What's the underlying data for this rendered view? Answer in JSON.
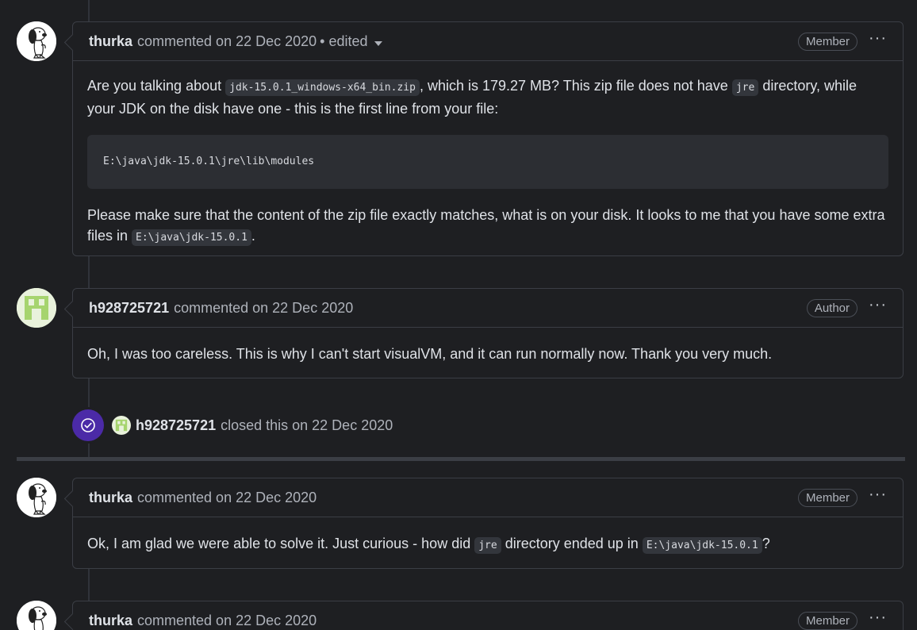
{
  "comments": [
    {
      "author": "thurka",
      "meta": "commented on 22 Dec 2020",
      "edited": "• edited",
      "role": "Member",
      "avatar_icon": "snoopy-avatar-icon",
      "body": {
        "p1_a": "Are you talking about ",
        "p1_code1": "jdk-15.0.1_windows-x64_bin.zip",
        "p1_b": ", which is 179.27 MB? This zip file does not have ",
        "p1_code2": "jre",
        "p1_c": " directory, while your JDK on the disk have one - this is the first line from your file:",
        "codeblock": "E:\\java\\jdk-15.0.1\\jre\\lib\\modules",
        "p2_a": "Please make sure that the content of the zip file exactly matches, what is on your disk. It looks to me that you have some extra files in ",
        "p2_code": "E:\\java\\jdk-15.0.1",
        "p2_b": "."
      }
    },
    {
      "author": "h928725721",
      "meta": "commented on 22 Dec 2020",
      "role": "Author",
      "avatar_icon": "identicon-avatar-icon",
      "body": {
        "text": "Oh, I was too careless. This is why I can't start visualVM, and it can run normally now. Thank you very much."
      }
    },
    {
      "author": "thurka",
      "meta": "commented on 22 Dec 2020",
      "role": "Member",
      "avatar_icon": "snoopy-avatar-icon",
      "body": {
        "a": "Ok, I am glad we were able to solve it. Just curious - how did ",
        "code1": "jre",
        "b": " directory ended up in ",
        "code2": "E:\\java\\jdk-15.0.1",
        "c": "?"
      }
    },
    {
      "author": "thurka",
      "meta": "commented on 22 Dec 2020",
      "role": "Member",
      "avatar_icon": "snoopy-avatar-icon"
    }
  ],
  "event": {
    "icon": "check-circle-icon",
    "actor": "h928725721",
    "text": "closed this on 22 Dec 2020",
    "color": "#4b2aa7"
  },
  "kebab_label": "···",
  "colors": {
    "background": "#1e1f22",
    "border": "#3b3e45",
    "text": "#dfe2e7",
    "muted": "#aeb2ba",
    "closed_purple": "#4b2aa7"
  }
}
